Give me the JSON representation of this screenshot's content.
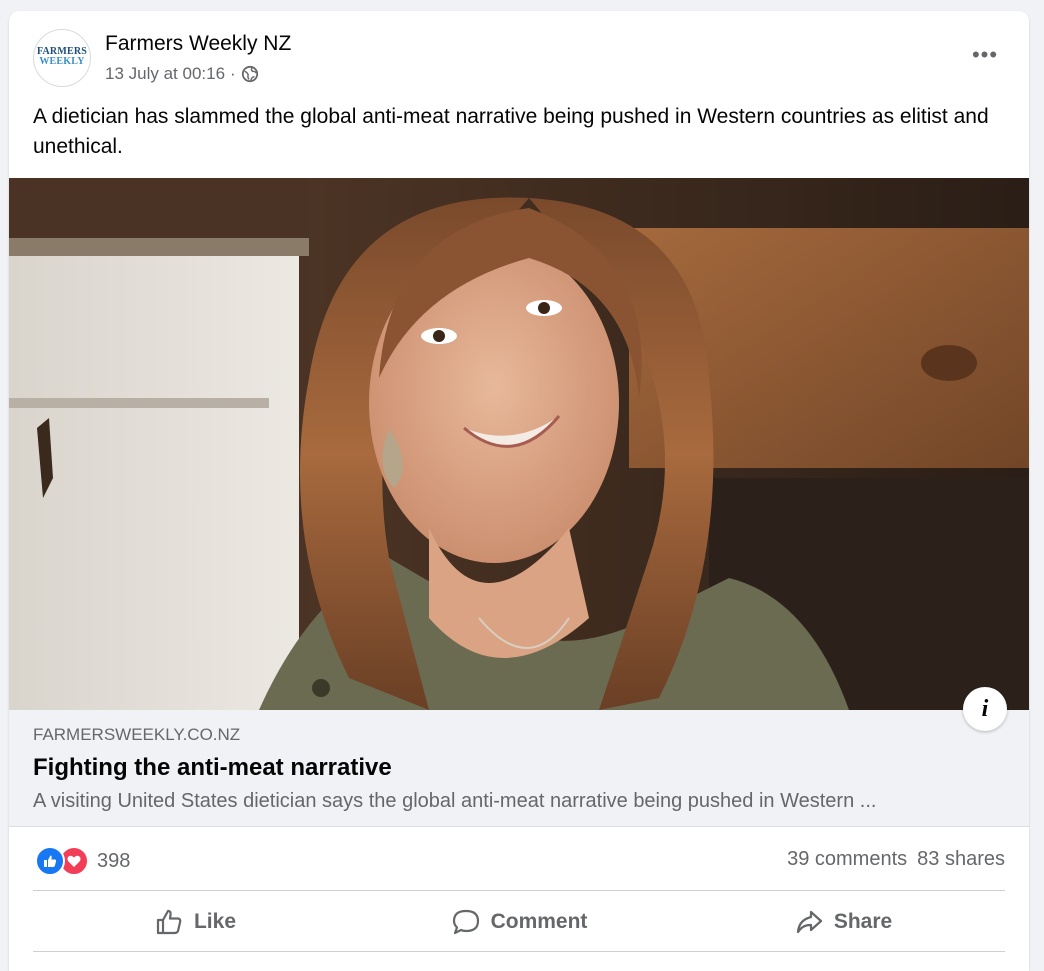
{
  "post": {
    "page_name": "Farmers Weekly NZ",
    "avatar": {
      "line1": "FARMERS",
      "line2": "WEEKLY",
      "tag": ""
    },
    "timestamp": "13 July at 00:16",
    "separator": "·",
    "privacy_icon": "globe-icon",
    "more_icon": "more-options-icon",
    "more_label": "•••",
    "text": "A dietician has slammed the global anti-meat narrative being pushed in Western countries as elitist and unethical."
  },
  "link_preview": {
    "domain": "FARMERSWEEKLY.CO.NZ",
    "title": "Fighting the anti-meat narrative",
    "description": "A visiting United States dietician says the global anti-meat narrative being pushed in Western ...",
    "info_label": "i"
  },
  "engagement": {
    "reactions": [
      "like",
      "love"
    ],
    "reaction_count": "398",
    "comments": "39 comments",
    "shares": "83 shares"
  },
  "actions": {
    "like_label": "Like",
    "comment_label": "Comment",
    "share_label": "Share"
  },
  "colors": {
    "like_blue": "#1877f2",
    "love_red": "#f33e58",
    "secondary_text": "#65676b",
    "link_box_bg": "#f0f2f5"
  }
}
